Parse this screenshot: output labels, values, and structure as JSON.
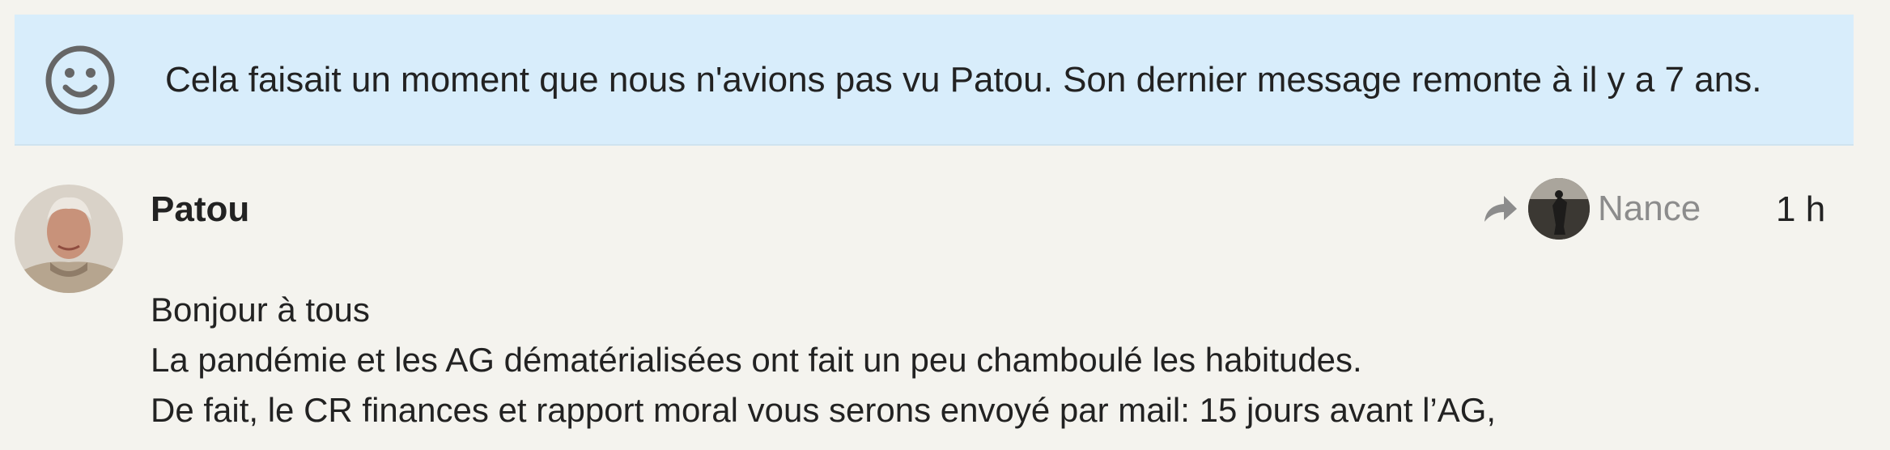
{
  "notice": {
    "icon": "smile-icon",
    "text": "Cela faisait un moment que nous n'avions pas vu Patou. Son dernier message remonte à il y a 7 ans.",
    "background": "#d8edfb"
  },
  "post": {
    "author": "Patou",
    "reply_to": {
      "icon": "reply-arrow-icon",
      "name": "Nance"
    },
    "time": "1 h",
    "lines": [
      "Bonjour à tous",
      "La pandémie et les AG dématérialisées ont fait un peu chamboulé les habitudes.",
      "De fait, le CR finances et rapport moral vous serons envoyé par mail: 15 jours avant l’AG,"
    ]
  }
}
